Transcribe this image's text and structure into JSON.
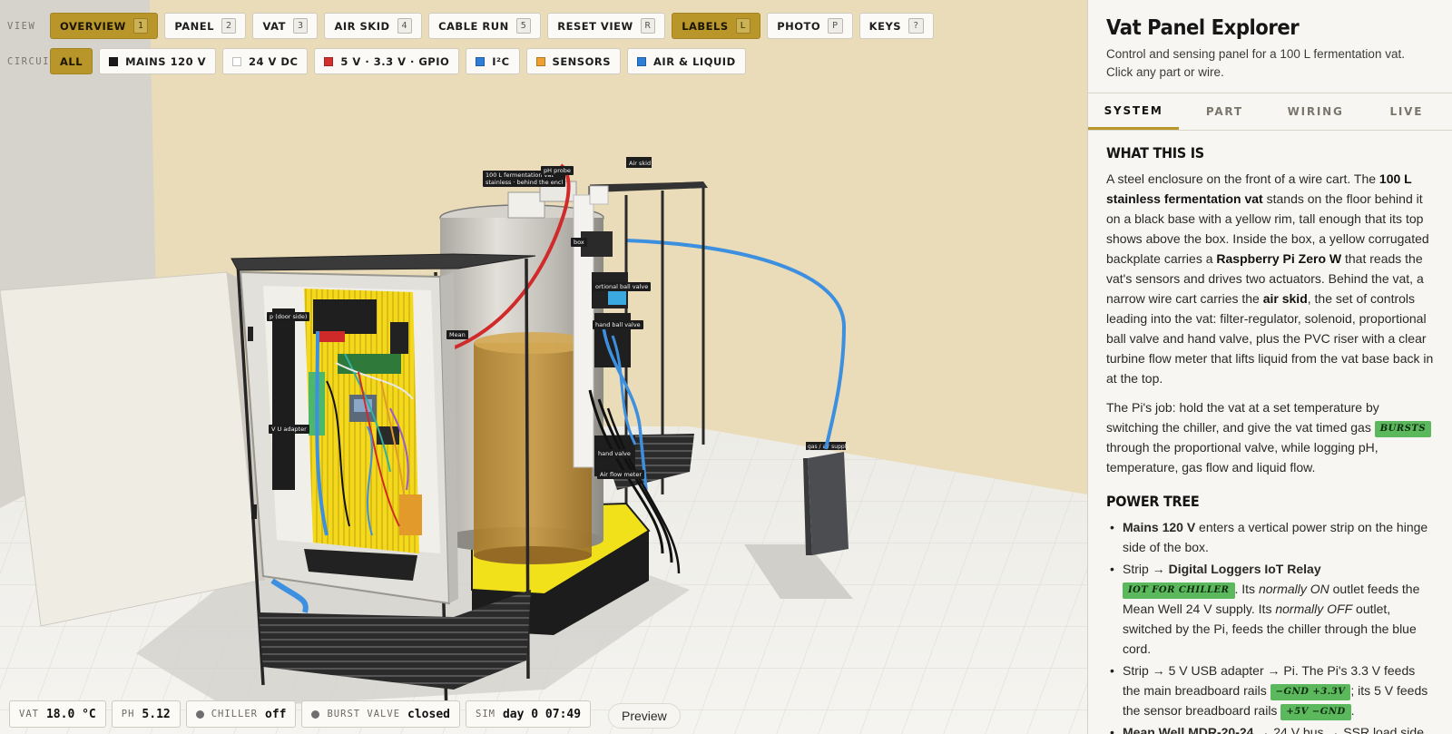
{
  "toolbar": {
    "view_label": "VIEW",
    "view_buttons": [
      {
        "label": "OVERVIEW",
        "key": "1",
        "active": true
      },
      {
        "label": "PANEL",
        "key": "2",
        "active": false
      },
      {
        "label": "VAT",
        "key": "3",
        "active": false
      },
      {
        "label": "AIR SKID",
        "key": "4",
        "active": false
      },
      {
        "label": "CABLE RUN",
        "key": "5",
        "active": false
      },
      {
        "label": "RESET VIEW",
        "key": "R",
        "active": false
      },
      {
        "label": "LABELS",
        "key": "L",
        "active": true
      },
      {
        "label": "PHOTO",
        "key": "P",
        "active": false
      },
      {
        "label": "KEYS",
        "key": "?",
        "active": false
      }
    ],
    "circuit_label": "CIRCUIT",
    "circuit_buttons": [
      {
        "label": "ALL",
        "swatch": "",
        "active": true
      },
      {
        "label": "MAINS 120 V",
        "swatch": "#1a1a1a",
        "active": false
      },
      {
        "label": "24 V DC",
        "swatch": "#ffffff",
        "active": false
      },
      {
        "label": "5 V · 3.3 V · GPIO",
        "swatch": "#d32f2f",
        "active": false
      },
      {
        "label": "I²C",
        "swatch": "#2e7dd7",
        "active": false
      },
      {
        "label": "SENSORS",
        "swatch": "#f0a030",
        "active": false
      },
      {
        "label": "AIR & LIQUID",
        "swatch": "#2e7dd7",
        "active": false
      }
    ]
  },
  "scene_labels": {
    "vat": "100 L fermentation vat",
    "vat2": "stainless · behind the encl",
    "ph": "pH probe",
    "air_skid": "Air skid",
    "box": "box",
    "prop_valve": "ortional ball valve",
    "hand_valve": "hand ball valve",
    "strip": "p (door side)",
    "adapter": "V U  adapter",
    "hand_valve2": "hand valve",
    "flow": "Air flow meter",
    "gas": "gas / air supply",
    "mean": "Mean"
  },
  "status": {
    "vat_k": "VAT",
    "vat_v": "18.0 °C",
    "ph_k": "PH",
    "ph_v": "5.12",
    "chiller_k": "CHILLER",
    "chiller_v": "off",
    "burst_k": "BURST VALVE",
    "burst_v": "closed",
    "sim_k": "SIM",
    "sim_v": "day 0 07:49"
  },
  "preview": "Preview",
  "panel": {
    "title": "Vat Panel Explorer",
    "subtitle": "Control and sensing panel for a 100 L fermentation vat. Click any part or wire.",
    "tabs": [
      "SYSTEM",
      "PART",
      "WIRING",
      "LIVE"
    ],
    "what_heading": "WHAT THIS IS",
    "what_p1_a": "A steel enclosure on the front of a wire cart. The ",
    "what_p1_b": "100 L stainless fermentation vat",
    "what_p1_c": " stands on the floor behind it on a black base with a yellow rim, tall enough that its top shows above the box. Inside the box, a yellow corrugated backplate carries a ",
    "what_p1_d": "Raspberry Pi Zero W",
    "what_p1_e": " that reads the vat's sensors and drives two actuators. Behind the vat, a narrow wire cart carries the ",
    "what_p1_f": "air skid",
    "what_p1_g": ", the set of controls leading into the vat: filter-regulator, solenoid, proportional ball valve and hand valve, plus the PVC riser with a clear turbine flow meter that lifts liquid from the vat base back in at the top.",
    "what_p2_a": "The Pi's job: hold the vat at a set temperature by switching the chiller, and give the vat timed gas ",
    "what_p2_tag": "BURSTS",
    "what_p2_b": " through the proportional valve, while logging pH, temperature, gas flow and liquid flow.",
    "power_heading": "POWER TREE",
    "p1_a": "Mains 120 V",
    "p1_b": " enters a vertical power strip on the hinge side of the box.",
    "p2_a": "Strip → ",
    "p2_b": "Digital Loggers IoT Relay",
    "p2_tag": "IOT FOR CHILLER",
    "p2_c": ". Its ",
    "p2_d": "normally ON",
    "p2_e": " outlet feeds the Mean Well 24 V supply. Its ",
    "p2_f": "normally OFF",
    "p2_g": " outlet, switched by the Pi, feeds the chiller through the blue cord.",
    "p3_a": "Strip → 5 V USB adapter → Pi. The Pi's 3.3 V feeds the main breadboard rails ",
    "p3_tag": "−GND +3.3V",
    "p3_b": "; its 5 V feeds the sensor breadboard rails ",
    "p3_tag2": "+5V −GND",
    "p3_c": ".",
    "p4_a": "Mean Well MDR-20-24",
    "p4_b": " → 24 V bus → SSR load side"
  }
}
